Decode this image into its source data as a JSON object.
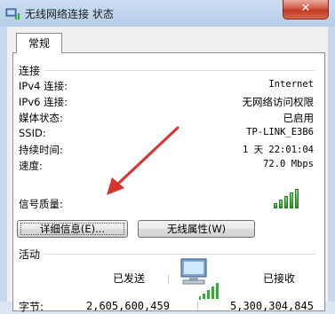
{
  "window": {
    "title": "无线网络连接 状态",
    "close_label": "✕"
  },
  "tabs": [
    {
      "label": "常规"
    }
  ],
  "connection": {
    "heading": "连接",
    "rows": [
      {
        "label": "IPv4 连接:",
        "value": "Internet"
      },
      {
        "label": "IPv6 连接:",
        "value": "无网络访问权限"
      },
      {
        "label": "媒体状态:",
        "value": "已启用"
      },
      {
        "label": "SSID:",
        "value": "TP-LINK_E3B6"
      },
      {
        "label": "持续时间:",
        "value": "1 天 22:01:04"
      },
      {
        "label": "速度:",
        "value": "72.0 Mbps"
      }
    ],
    "signal_label": "信号质量:",
    "signal_bars": 5
  },
  "buttons": {
    "details": "详细信息(E)...",
    "wireless_props": "无线属性(W)"
  },
  "activity": {
    "heading": "活动",
    "sent_label": "已发送",
    "received_label": "已接收",
    "bytes_label": "字节:",
    "bytes_sent": "2,605,600,459",
    "bytes_received": "5,300,304,845"
  },
  "colors": {
    "arrow": "#d9342b",
    "signal": "#2fae2f",
    "titlebar": "#c4d6ee"
  }
}
